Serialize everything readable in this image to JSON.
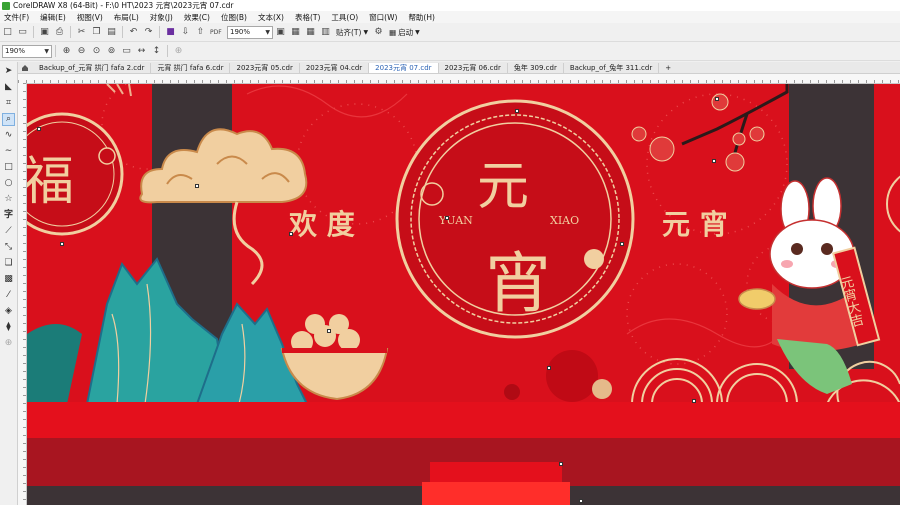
{
  "window": {
    "title": "CorelDRAW X8 (64-Bit) - F:\\0 HT\\2023 元宵\\2023元宵 07.cdr"
  },
  "menu": [
    "文件(F)",
    "编辑(E)",
    "视图(V)",
    "布局(L)",
    "对象(J)",
    "效果(C)",
    "位图(B)",
    "文本(X)",
    "表格(T)",
    "工具(O)",
    "窗口(W)",
    "帮助(H)"
  ],
  "toolbar1": {
    "zoom": "190%",
    "paste_label": "贴齐(T)",
    "launch_label": "启动"
  },
  "toolbar2": {
    "zoom": "190%"
  },
  "tabs": [
    {
      "label": "Backup_of_元宵 拱门 fafa 2.cdr",
      "active": false
    },
    {
      "label": "元宵 拱门 fafa 6.cdr",
      "active": false
    },
    {
      "label": "2023元宵 05.cdr",
      "active": false
    },
    {
      "label": "2023元宵 04.cdr",
      "active": false
    },
    {
      "label": "2023元宵 07.cdr",
      "active": true
    },
    {
      "label": "2023元宵 06.cdr",
      "active": false
    },
    {
      "label": "兔年 309.cdr",
      "active": false
    },
    {
      "label": "Backup_of_兔年 311.cdr",
      "active": false
    }
  ],
  "artwork": {
    "fu_char": "福",
    "left_phrase": "欢 度",
    "right_phrase": "元 宵",
    "center_top_char": "元",
    "center_bottom_char": "宵",
    "center_left_word": "YUAN",
    "center_right_word": "XIAO",
    "scroll_text": "元宵大吉",
    "colors": {
      "red": "#d9101c",
      "dark_red": "#a80d16",
      "gold": "#f1cfa0",
      "dark_panel": "#3c3336",
      "teal": "#2aa3a0"
    }
  }
}
